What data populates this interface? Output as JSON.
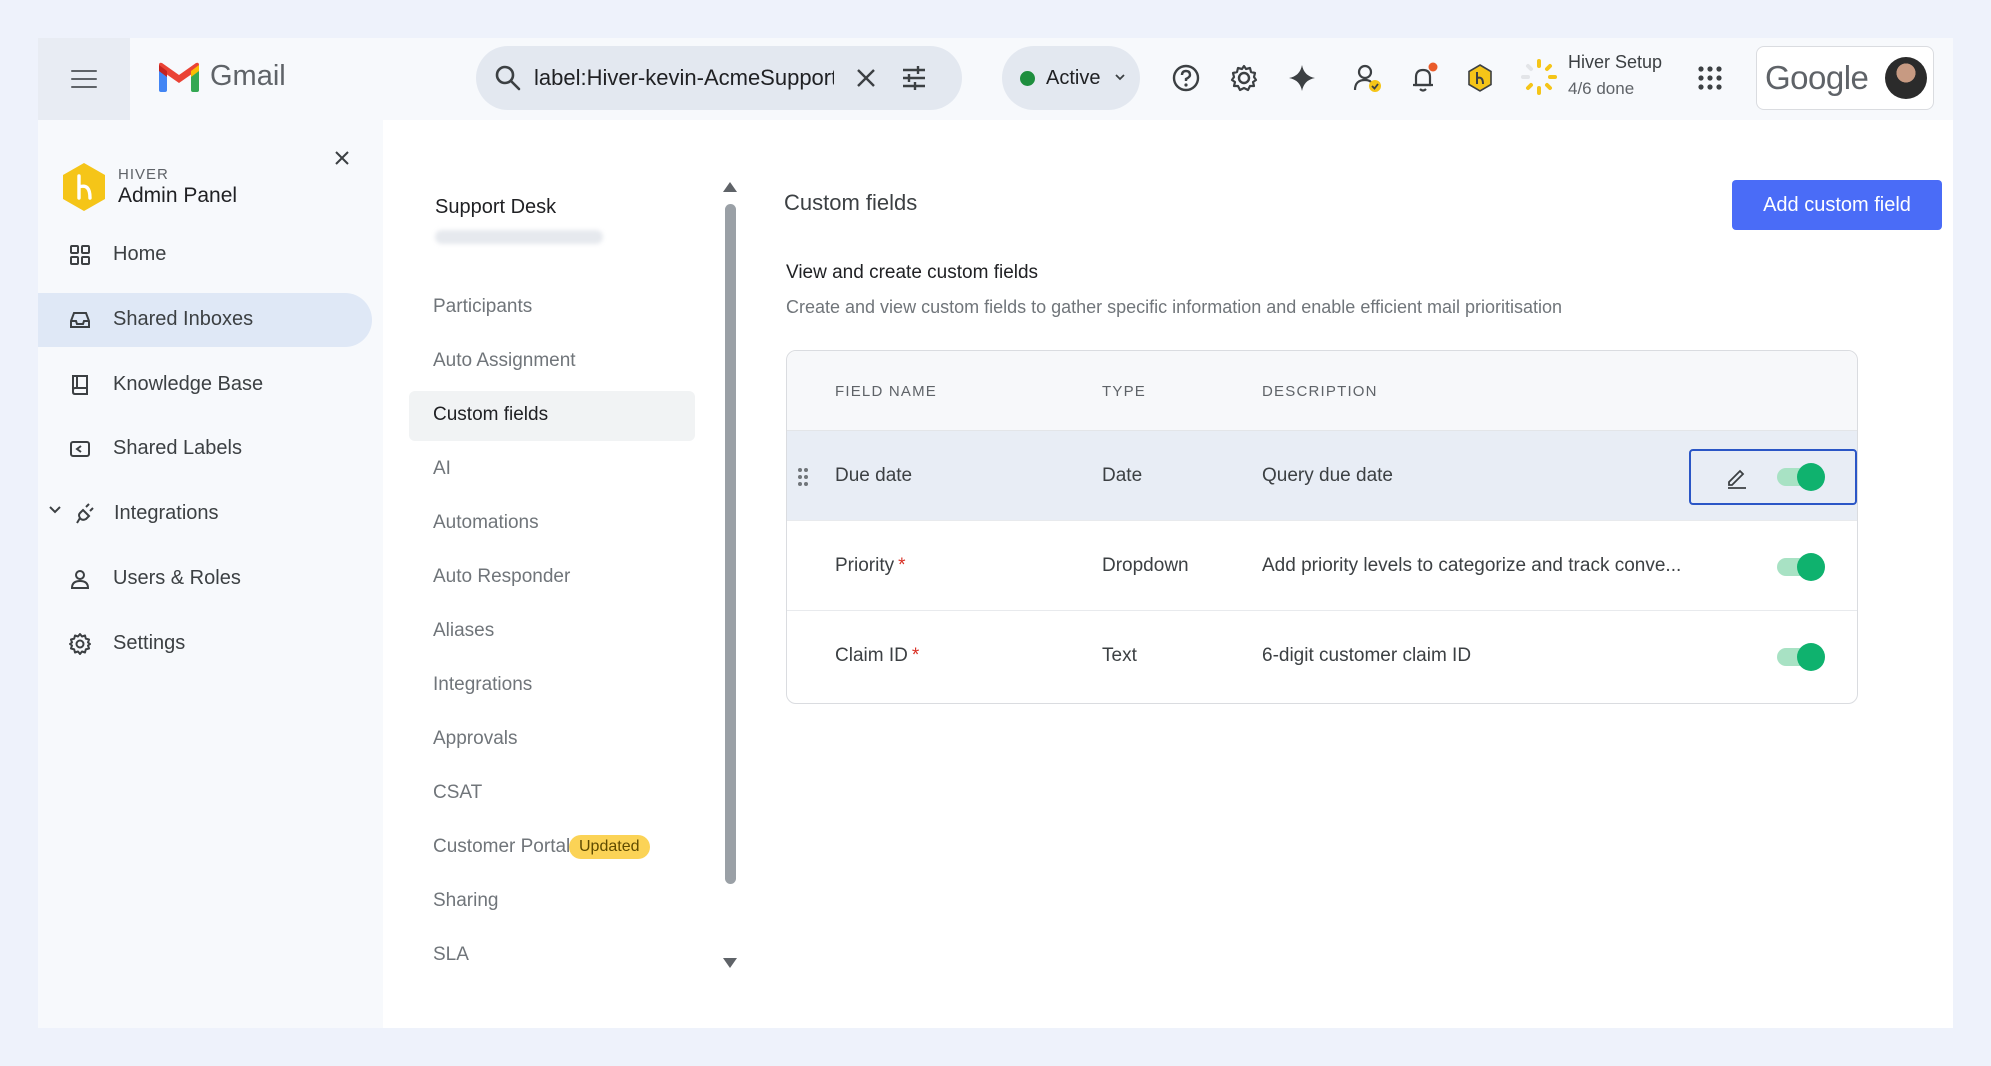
{
  "app": {
    "name": "Gmail"
  },
  "search": {
    "value": "label:Hiver-kevin-AcmeSupport"
  },
  "status": {
    "label": "Active",
    "color": "#1e8e3e"
  },
  "setup": {
    "title": "Hiver Setup",
    "progress": "4/6 done"
  },
  "account": {
    "brand": "Google"
  },
  "sidebar": {
    "brand_small": "HIVER",
    "brand_title": "Admin Panel",
    "items": [
      {
        "label": "Home",
        "icon": "grid-icon"
      },
      {
        "label": "Shared Inboxes",
        "icon": "inbox-icon",
        "active": true
      },
      {
        "label": "Knowledge Base",
        "icon": "book-icon"
      },
      {
        "label": "Shared Labels",
        "icon": "label-icon"
      },
      {
        "label": "Integrations",
        "icon": "plug-icon"
      },
      {
        "label": "Users & Roles",
        "icon": "user-icon"
      },
      {
        "label": "Settings",
        "icon": "gear-icon"
      }
    ]
  },
  "subnav": {
    "title": "Support Desk",
    "items": [
      {
        "label": "Participants"
      },
      {
        "label": "Auto Assignment"
      },
      {
        "label": "Custom fields",
        "active": true
      },
      {
        "label": "AI"
      },
      {
        "label": "Automations"
      },
      {
        "label": "Auto Responder"
      },
      {
        "label": "Aliases"
      },
      {
        "label": "Integrations"
      },
      {
        "label": "Approvals"
      },
      {
        "label": "CSAT"
      },
      {
        "label": "Customer Portal",
        "badge": "Updated"
      },
      {
        "label": "Sharing"
      },
      {
        "label": "SLA"
      }
    ]
  },
  "content": {
    "title": "Custom fields",
    "add_button": "Add custom field",
    "heading": "View and create custom fields",
    "description": "Create and view custom fields to gather specific information and enable efficient mail prioritisation",
    "columns": [
      "FIELD NAME",
      "TYPE",
      "DESCRIPTION"
    ],
    "rows": [
      {
        "name": "Due date",
        "required": false,
        "type": "Date",
        "description": "Query due date",
        "enabled": true
      },
      {
        "name": "Priority",
        "required": true,
        "type": "Dropdown",
        "description": "Add priority levels to categorize and track conve...",
        "enabled": true
      },
      {
        "name": "Claim ID",
        "required": true,
        "type": "Text",
        "description": "6-digit customer claim ID",
        "enabled": true
      }
    ],
    "required_marker": "*"
  },
  "colors": {
    "accent": "#4a6cf7",
    "toggle_on": "#0fb26e",
    "badge": "#fbd356",
    "brand_hex": "#f5c518"
  }
}
